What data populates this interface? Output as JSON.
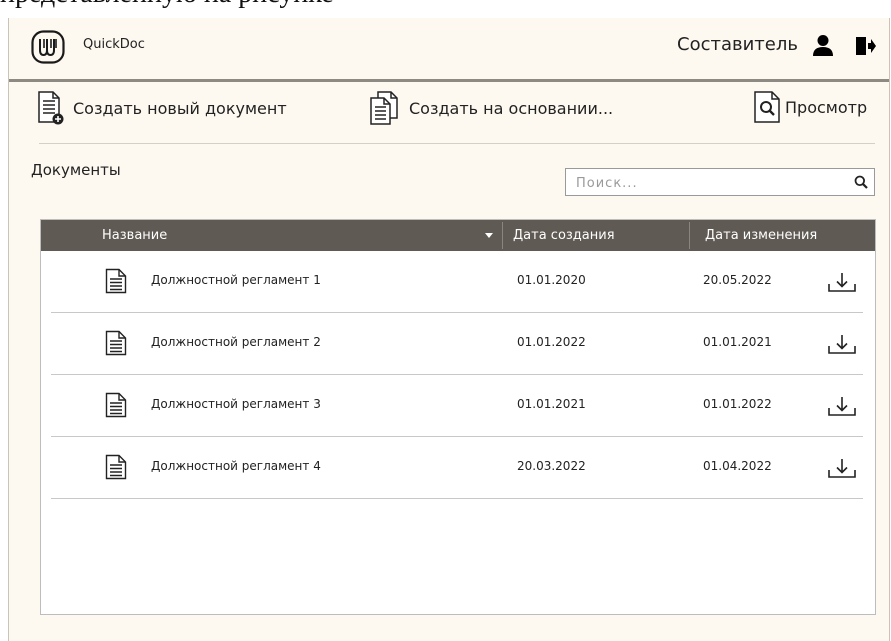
{
  "caption": "представленную на рисунке",
  "app": {
    "name": "QuickDoc",
    "role": "Составитель"
  },
  "toolbar": {
    "create_new": "Создать новый документ",
    "create_based": "Создать на основании...",
    "preview": "Просмотр"
  },
  "section": {
    "title": "Документы"
  },
  "search": {
    "placeholder": "Поиск..."
  },
  "table": {
    "headers": [
      "Название",
      "Дата создания",
      "Дата изменения"
    ],
    "rows": [
      {
        "name": "Должностной регламент 1",
        "created": "01.01.2020",
        "modified": "20.05.2022"
      },
      {
        "name": "Должностной регламент 2",
        "created": "01.01.2022",
        "modified": "01.01.2021"
      },
      {
        "name": "Должностной регламент 3",
        "created": "01.01.2021",
        "modified": "01.01.2022"
      },
      {
        "name": "Должностной регламент 4",
        "created": "20.03.2022",
        "modified": "01.04.2022"
      }
    ]
  },
  "colors": {
    "app_background": "#fdf9f0",
    "table_header": "#5f5a53",
    "header_border": "#8d8a84"
  },
  "icons": [
    "logo-icon",
    "user-icon",
    "logout-icon",
    "new-document-icon",
    "copy-document-icon",
    "preview-icon",
    "search-icon",
    "document-icon",
    "download-icon",
    "sort-caret-icon"
  ]
}
